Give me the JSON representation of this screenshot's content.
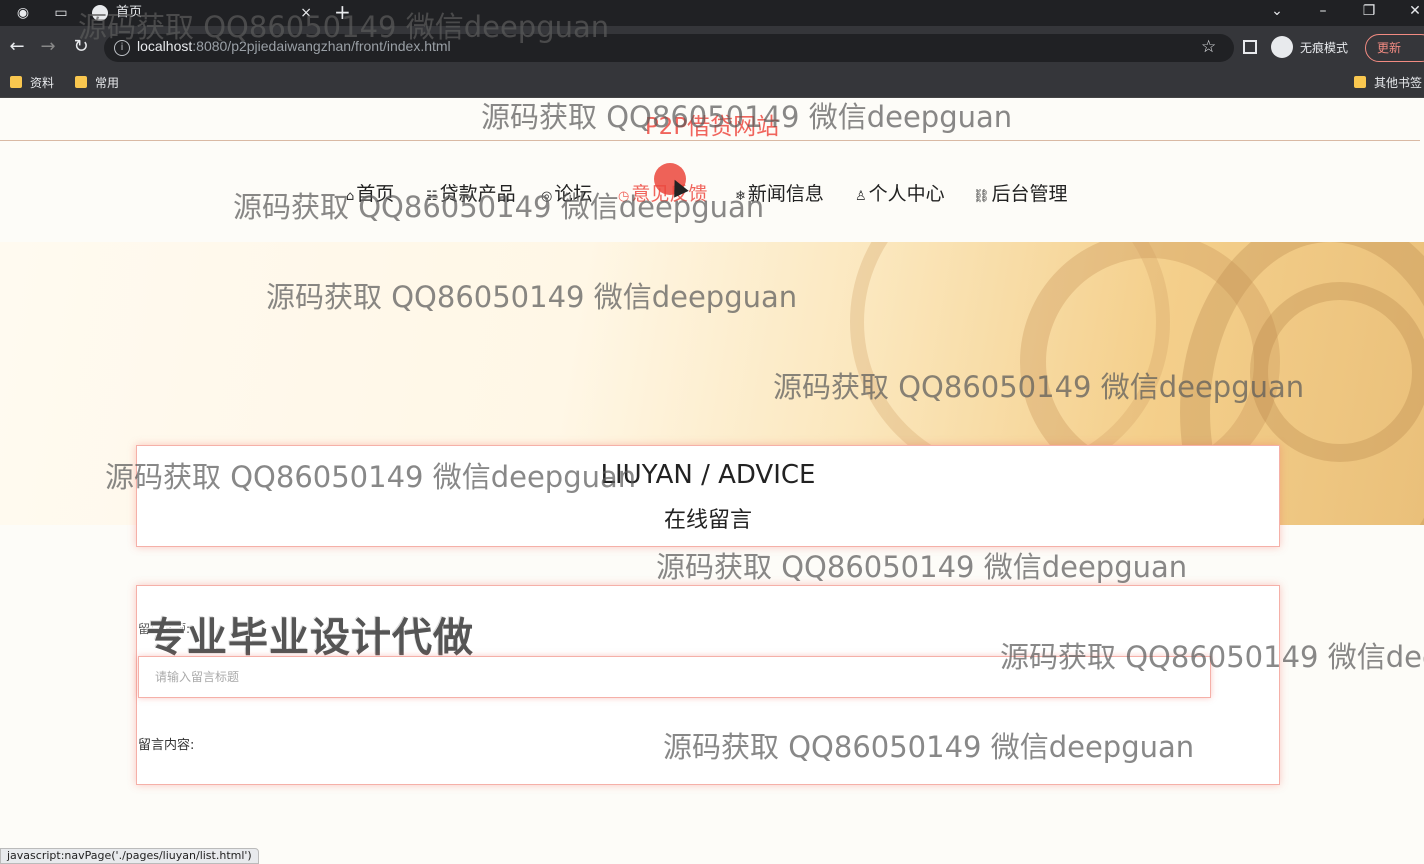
{
  "browser": {
    "tab_title": "首页",
    "new_tab": "+",
    "tab_close": "×",
    "url_host": "localhost",
    "url_rest": ":8080/p2pjiedaiwangzhan/front/index.html",
    "incognito_label": "无痕模式",
    "update_label": "更新",
    "bookmarks": [
      "资料",
      "常用"
    ],
    "other_bookmarks": "其他书签"
  },
  "site": {
    "title": "P2P借贷网站",
    "nav": [
      {
        "icon": "⌂",
        "label": "首页"
      },
      {
        "icon": "☷",
        "label": "贷款产品"
      },
      {
        "icon": "◎",
        "label": "论坛"
      },
      {
        "icon": "◷",
        "label": "意见反馈"
      },
      {
        "icon": "❄",
        "label": "新闻信息"
      },
      {
        "icon": "♙",
        "label": "个人中心"
      },
      {
        "icon": "🔗",
        "label": "后台管理"
      }
    ],
    "active_nav": "意见反馈"
  },
  "banner": {
    "slide_count": 3,
    "active_slide": 1
  },
  "section": {
    "title_en": "LIUYAN / ADVICE",
    "title_cn": "在线留言"
  },
  "form": {
    "promo_overlay": "专业毕业设计代做",
    "title_label": "留言标题:",
    "title_placeholder": "请输入留言标题",
    "content_label": "留言内容:"
  },
  "status_bar": "javascript:navPage('./pages/liuyan/list.html')",
  "watermark": "源码获取 QQ86050149 微信deepguan",
  "colors": {
    "accent": "#f0645c",
    "chrome_dark": "#202124",
    "chrome_toolbar": "#35363a"
  }
}
